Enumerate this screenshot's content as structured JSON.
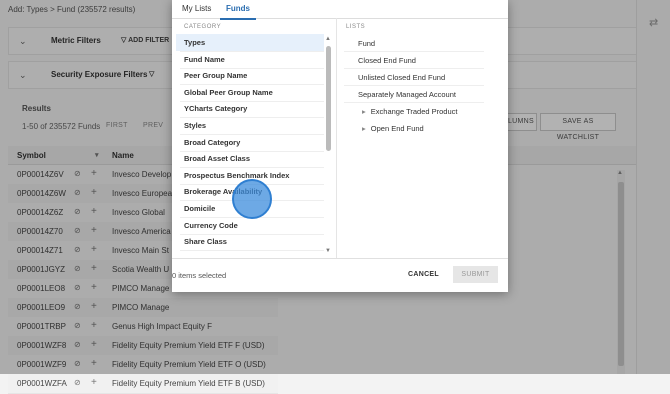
{
  "background": {
    "breadcrumb": "Add: Types > Fund (235572 results)",
    "metric_filters": {
      "title": "Metric Filters",
      "add_filter": "ADD FILTER"
    },
    "security_exposure_filters": {
      "title": "Security Exposure Filters"
    },
    "results": {
      "label": "Results",
      "count": "1-50 of 235572 Funds",
      "first": "FIRST",
      "prev": "PREV",
      "columns_btn": "LUMNS",
      "watchlist_btn": "SAVE AS WATCHLIST"
    },
    "table": {
      "headers": [
        "Symbol",
        "Name"
      ],
      "rows": [
        {
          "symbol": "0P00014Z6V",
          "name": "Invesco Develop"
        },
        {
          "symbol": "0P00014Z6W",
          "name": "Invesco Europea"
        },
        {
          "symbol": "0P00014Z6Z",
          "name": "Invesco Global"
        },
        {
          "symbol": "0P00014Z70",
          "name": "Invesco America"
        },
        {
          "symbol": "0P00014Z71",
          "name": "Invesco Main St"
        },
        {
          "symbol": "0P0001JGYZ",
          "name": "Scotia Wealth U"
        },
        {
          "symbol": "0P0001LEO8",
          "name": "PIMCO Manage"
        },
        {
          "symbol": "0P0001LEO9",
          "name": "PIMCO Manage"
        },
        {
          "symbol": "0P0001TRBP",
          "name": "Genus High Impact Equity F"
        },
        {
          "symbol": "0P0001WZF8",
          "name": "Fidelity Equity Premium Yield ETF F (USD)"
        },
        {
          "symbol": "0P0001WZF9",
          "name": "Fidelity Equity Premium Yield ETF O (USD)"
        },
        {
          "symbol": "0P0001WZFA",
          "name": "Fidelity Equity Premium Yield ETF B (USD)"
        }
      ]
    }
  },
  "modal": {
    "tabs": [
      "My Lists",
      "Funds"
    ],
    "active_tab": "Funds",
    "category_header": "CATEGORY",
    "lists_header": "LISTS",
    "categories": [
      "Types",
      "Fund Name",
      "Peer Group Name",
      "Global Peer Group Name",
      "YCharts Category",
      "Styles",
      "Broad Category",
      "Broad Asset Class",
      "Prospectus Benchmark Index",
      "Brokerage Availability",
      "Domicile",
      "Currency Code",
      "Share Class"
    ],
    "lists": [
      {
        "label": "Fund",
        "indent": 0,
        "expander": ""
      },
      {
        "label": "Closed End Fund",
        "indent": 0,
        "expander": ""
      },
      {
        "label": "Unlisted Closed End Fund",
        "indent": 0,
        "expander": ""
      },
      {
        "label": "Separately Managed Account",
        "indent": 0,
        "expander": ""
      },
      {
        "label": "Exchange Traded Product",
        "indent": 1,
        "expander": "▸"
      },
      {
        "label": "Open End Fund",
        "indent": 1,
        "expander": "▸"
      }
    ],
    "selected_text": "0 items selected",
    "cancel": "CANCEL",
    "submit": "SUBMIT"
  }
}
